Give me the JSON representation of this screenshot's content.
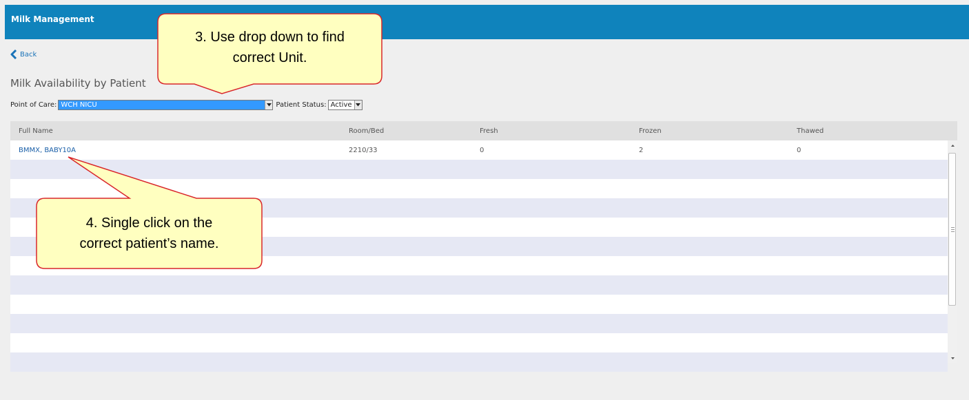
{
  "header": {
    "title": "Milk Management"
  },
  "nav": {
    "back_label": "Back"
  },
  "page": {
    "title": "Milk Availability by Patient"
  },
  "filters": {
    "point_of_care_label": "Point of Care:",
    "point_of_care_value": "WCH NICU",
    "patient_status_label": "Patient Status:",
    "patient_status_value": "Active"
  },
  "table": {
    "columns": [
      "Full Name",
      "Room/Bed",
      "Fresh",
      "Frozen",
      "Thawed"
    ],
    "rows": [
      {
        "full_name": "BMMX, BABY10A",
        "room_bed": "2210/33",
        "fresh": "0",
        "frozen": "2",
        "thawed": "0"
      }
    ]
  },
  "callouts": {
    "step3": {
      "line1": "3. Use drop down to find",
      "line2": "correct Unit."
    },
    "step4": {
      "line1": "4. Single click on the",
      "line2": "correct patient’s name."
    }
  },
  "colors": {
    "header_bg": "#0f83bc",
    "callout_fill": "#ffffc0",
    "callout_border": "#d9262b",
    "selection_bg": "#3399ff",
    "row_alt_bg": "#e6e8f4"
  }
}
